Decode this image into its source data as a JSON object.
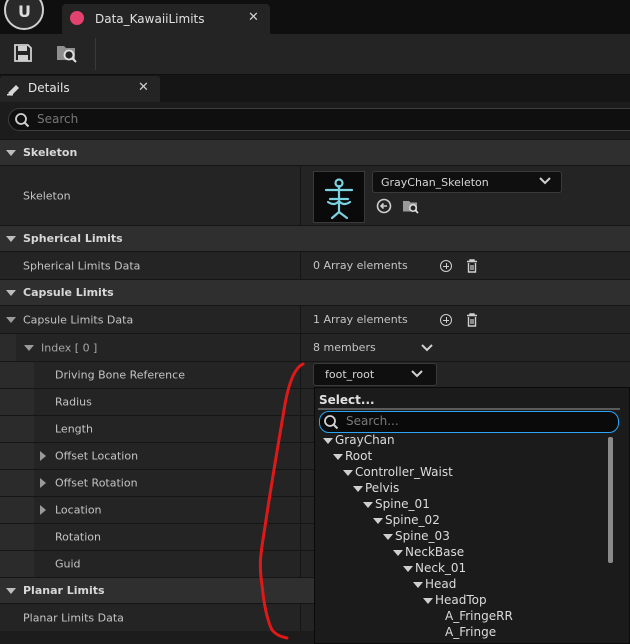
{
  "window": {
    "tab_title": "Data_KawaiiLimits",
    "tab_close": "✕"
  },
  "details": {
    "tab_label": "Details",
    "tab_close": "✕",
    "search_placeholder": "Search"
  },
  "categories": {
    "skeleton": "Skeleton",
    "spherical": "Spherical Limits",
    "capsule": "Capsule Limits",
    "planar": "Planar Limits"
  },
  "properties": {
    "skeleton_label": "Skeleton",
    "skeleton_value": "GrayChan_Skeleton",
    "spherical_label": "Spherical Limits Data",
    "spherical_value": "0 Array elements",
    "capsule_label": "Capsule Limits Data",
    "capsule_value": "1 Array elements",
    "index_label": "Index [ 0 ]",
    "index_value": "8 members",
    "driving_bone_label": "Driving Bone Reference",
    "driving_bone_value": "foot_root",
    "radius_label": "Radius",
    "length_label": "Length",
    "offset_location_label": "Offset Location",
    "offset_rotation_label": "Offset Rotation",
    "location_label": "Location",
    "rotation_label": "Rotation",
    "guid_label": "Guid",
    "planar_label": "Planar Limits Data"
  },
  "bone_picker": {
    "title": "Select...",
    "search_placeholder": "Search...",
    "tree": [
      {
        "name": "GrayChan",
        "depth": 0,
        "expanded": true
      },
      {
        "name": "Root",
        "depth": 1,
        "expanded": true
      },
      {
        "name": "Controller_Waist",
        "depth": 2,
        "expanded": true
      },
      {
        "name": "Pelvis",
        "depth": 3,
        "expanded": true
      },
      {
        "name": "Spine_01",
        "depth": 4,
        "expanded": true
      },
      {
        "name": "Spine_02",
        "depth": 5,
        "expanded": true
      },
      {
        "name": "Spine_03",
        "depth": 6,
        "expanded": true
      },
      {
        "name": "NeckBase",
        "depth": 7,
        "expanded": true
      },
      {
        "name": "Neck_01",
        "depth": 8,
        "expanded": true
      },
      {
        "name": "Head",
        "depth": 9,
        "expanded": true
      },
      {
        "name": "HeadTop",
        "depth": 10,
        "expanded": true
      },
      {
        "name": "A_FringeRR",
        "depth": 11,
        "expanded": false
      },
      {
        "name": "A_Fringe",
        "depth": 11,
        "expanded": false
      }
    ]
  },
  "colors": {
    "accent": "#2aa4f4",
    "tab_icon": "#e3426f",
    "annotation": "#e01818"
  }
}
